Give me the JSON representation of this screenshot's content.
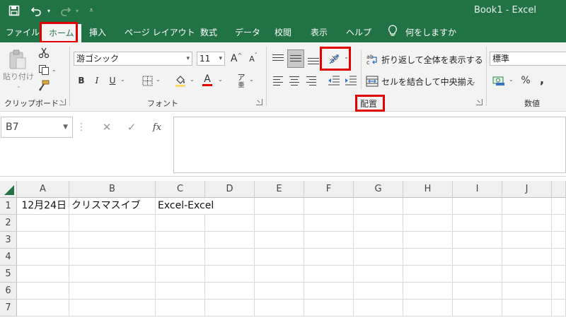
{
  "window": {
    "title": "Book1  -  Excel"
  },
  "quick_access": {
    "icons": [
      "save-icon",
      "undo-icon",
      "redo-icon",
      "customize-icon"
    ]
  },
  "tabs": [
    {
      "label": "ファイル"
    },
    {
      "label": "ホーム",
      "selected": true
    },
    {
      "label": "挿入"
    },
    {
      "label": "ページ レイアウト"
    },
    {
      "label": "数式"
    },
    {
      "label": "データ"
    },
    {
      "label": "校閲"
    },
    {
      "label": "表示"
    },
    {
      "label": "ヘルプ"
    }
  ],
  "tell_me": {
    "text": "何をしますか",
    "icon": "lightbulb-icon"
  },
  "ribbon": {
    "clipboard": {
      "paste_label": "貼り付け",
      "group_label": "クリップボード"
    },
    "font": {
      "font_name": "游ゴシック",
      "font_size": "11",
      "grow_label": "A",
      "shrink_label": "A",
      "bold_label": "B",
      "italic_label": "I",
      "underline_label": "U",
      "font_color_label": "A",
      "phonetic_label": "ア",
      "group_label": "フォント",
      "font_color": "#e00000"
    },
    "alignment": {
      "wrap_text_label": "折り返して全体を表示する",
      "merge_center_label": "セルを結合して中央揃え",
      "group_label": "配置",
      "orientation_icon": "text-orientation-icon"
    },
    "number": {
      "format": "標準",
      "percent_label": "%",
      "comma_label": ",",
      "group_label": "数値"
    }
  },
  "formula_bar": {
    "name_box": "B7",
    "cancel_symbol": "✕",
    "enter_symbol": "✓",
    "fx_label": "fx",
    "formula": ""
  },
  "sheet": {
    "columns": [
      "A",
      "B",
      "C",
      "D",
      "E",
      "F",
      "G",
      "H",
      "I",
      "J"
    ],
    "rows": [
      "1",
      "2",
      "3",
      "4",
      "5",
      "6",
      "7"
    ],
    "cells": {
      "A1": "12月24日",
      "B1": "クリスマスイブ",
      "C1": "Excel-Excel"
    }
  },
  "colors": {
    "brand_green": "#217346",
    "highlight_red": "#e00000"
  }
}
